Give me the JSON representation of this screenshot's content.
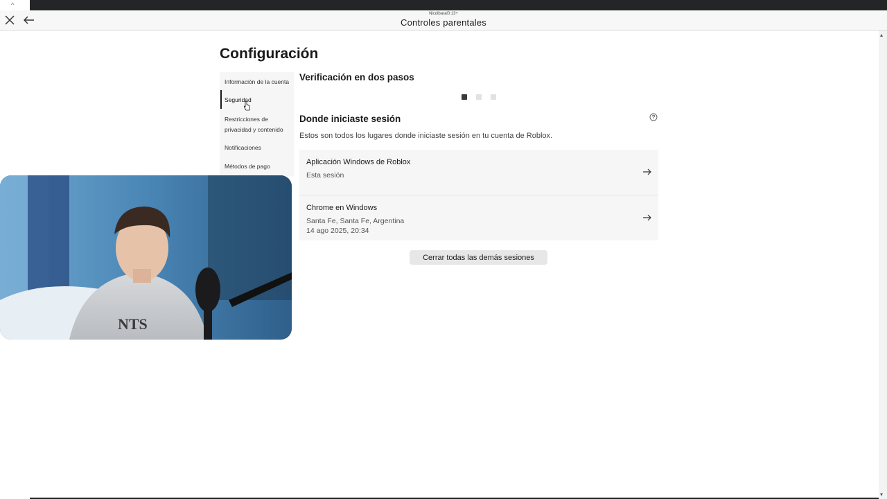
{
  "window": {
    "username": "Nicolbaral0:13+",
    "title": "Controles parentales"
  },
  "page": {
    "title": "Configuración"
  },
  "sidebar": {
    "items": [
      {
        "label": "Información de la cuenta",
        "active": false
      },
      {
        "label": "Seguridad",
        "active": true
      },
      {
        "label": "Restricciones de privacidad y contenido",
        "active": false
      },
      {
        "label": "Notificaciones",
        "active": false
      },
      {
        "label": "Métodos de pago",
        "active": false
      }
    ]
  },
  "main": {
    "two_step_heading": "Verificación en dos pasos",
    "carousel": {
      "count": 3,
      "active_index": 0
    },
    "sessions_heading": "Donde iniciaste sesión",
    "sessions_description": "Estos son todos los lugares donde iniciaste sesión en tu cuenta de Roblox.",
    "sessions": [
      {
        "name": "Aplicación Windows de Roblox",
        "line1": "Esta sesión",
        "line2": ""
      },
      {
        "name": "Chrome en Windows",
        "line1": "Santa Fe, Santa Fe, Argentina",
        "line2": "14 ago 2025, 20:34"
      }
    ],
    "logout_all_label": "Cerrar todas las demás sesiones"
  },
  "icons": {
    "close": "close-icon",
    "back": "arrow-left-icon",
    "help": "help-circle-icon",
    "session_arrow": "arrow-right-icon"
  },
  "colors": {
    "sidebar_bg": "#f6f6f6",
    "card_bg": "#f6f6f6",
    "button_bg": "#e7e7e7",
    "active_indicator": "#1a1a1a"
  }
}
